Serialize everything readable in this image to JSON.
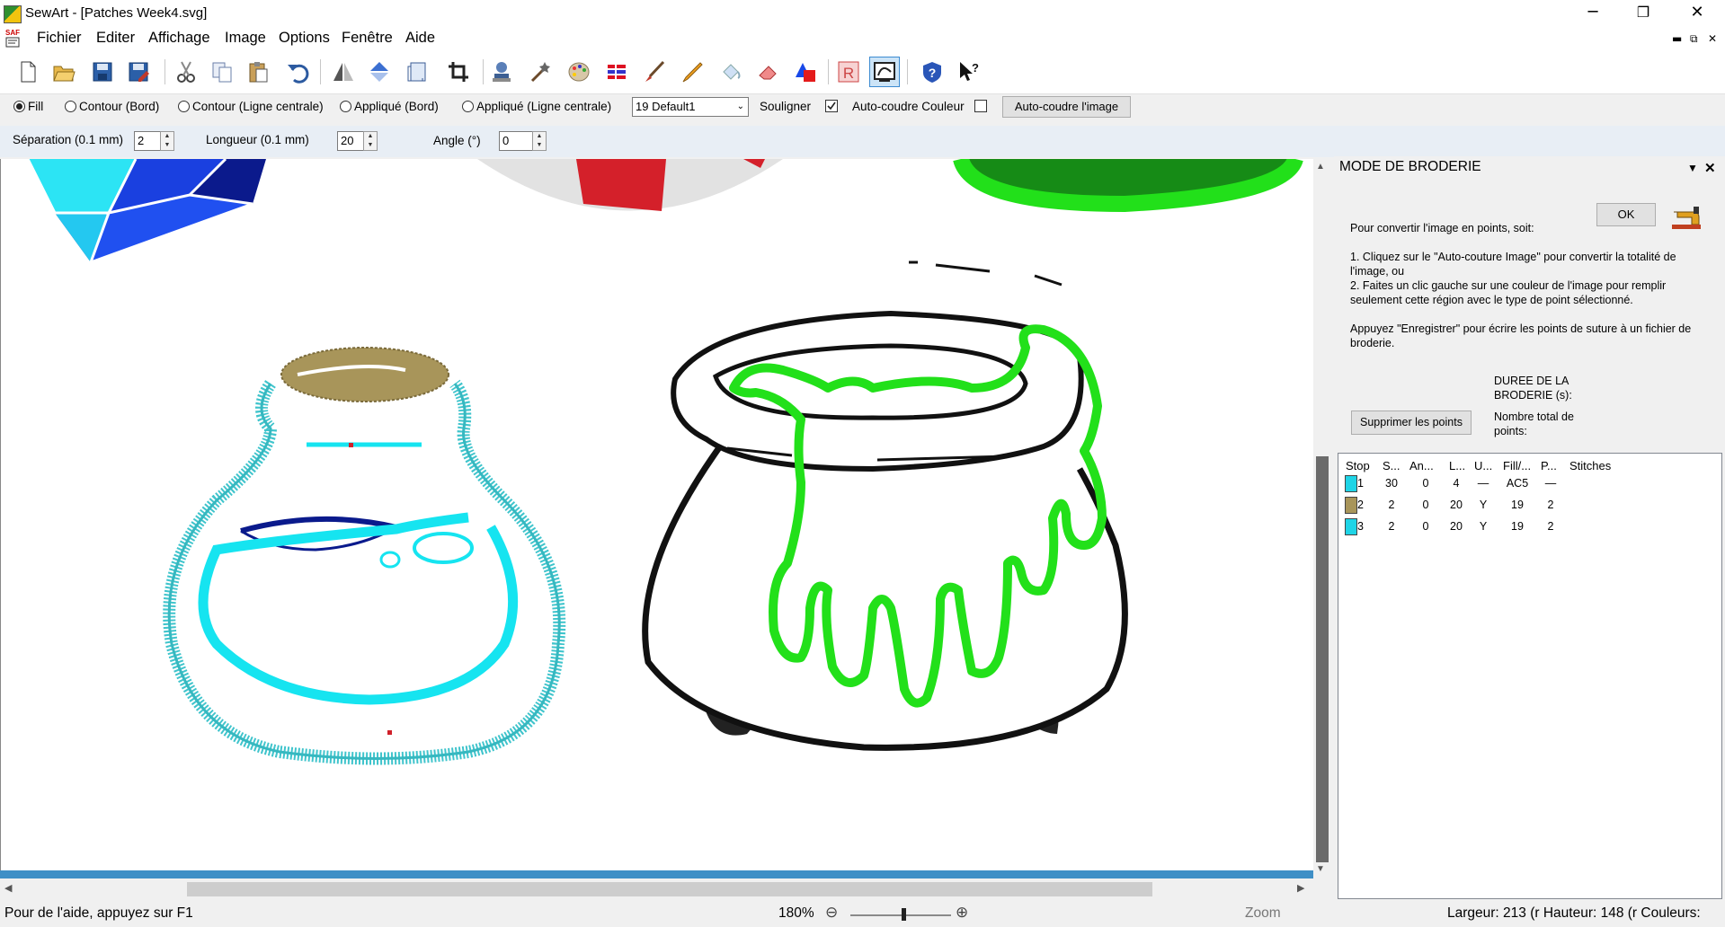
{
  "window": {
    "title": "SewArt - [Patches Week4.svg]",
    "minimize_glyph": "─",
    "restore_glyph": "❐",
    "close_glyph": "✕",
    "mdi_minimize_glyph": "▬",
    "mdi_restore_glyph": "⧉",
    "mdi_close_glyph": "✕"
  },
  "doc_icon_text": "SAF",
  "menu": [
    "Fichier",
    "Editer",
    "Affichage",
    "Image",
    "Options",
    "Fenêtre",
    "Aide"
  ],
  "toolbar_icons": [
    "new-file-icon",
    "open-folder-icon",
    "save-icon",
    "save-as-icon",
    "cut-icon",
    "copy-icon",
    "paste-icon",
    "undo-icon",
    "mirror-icon",
    "flip-icon",
    "rotate-page-icon",
    "crop-icon",
    "stamp-icon",
    "magic-wand-icon",
    "palette-icon",
    "stitch-list-icon",
    "brush-icon",
    "pencil-icon",
    "fill-icon",
    "eraser-icon",
    "shapes-icon",
    "registration-icon",
    "embroidery-mode-icon",
    "help-icon",
    "context-help-icon"
  ],
  "fill_options": {
    "fill": "Fill",
    "contour_edge": "Contour (Bord)",
    "contour_center": "Contour (Ligne centrale)",
    "applique_edge": "Appliqué (Bord)",
    "applique_center": "Appliqué (Ligne centrale)",
    "selected": "fill",
    "pattern_value": "19 Default1",
    "underline_label": "Souligner",
    "underline_checked": true,
    "auto_color_label": "Auto-coudre Couleur",
    "auto_color_checked": false,
    "auto_image_button": "Auto-coudre l'image"
  },
  "params": {
    "separation_label": "Séparation (0.1 mm)",
    "separation_value": "2",
    "length_label": "Longueur (0.1 mm)",
    "length_value": "20",
    "angle_label": "Angle (°)",
    "angle_value": "0"
  },
  "panel": {
    "title": "MODE DE BRODERIE",
    "ok_button": "OK",
    "intro": "Pour convertir l'image en points, soit:",
    "step1": "1. Cliquez sur le \"Auto-couture Image\" pour convertir la totalité de l'image, ou",
    "step2": "2. Faites un clic gauche sur une couleur de l'image pour remplir seulement cette région avec le type de point sélectionné.",
    "save_hint": "Appuyez \"Enregistrer\" pour écrire les points de suture à un fichier de broderie.",
    "duration_label": "DUREE DE LA BRODERIE (s):",
    "total_points_label": "Nombre total de points:",
    "delete_button": "Supprimer les points",
    "columns": [
      "Stop",
      "S...",
      "An...",
      "L...",
      "U...",
      "Fill/...",
      "P...",
      "Stitches"
    ],
    "rows": [
      {
        "stop": "1",
        "color": "#1fd4e6",
        "s": "30",
        "an": "0",
        "l": "4",
        "u": "—",
        "fill": "AC5",
        "p": "—",
        "stitches": ""
      },
      {
        "stop": "2",
        "color": "#a8955a",
        "s": "2",
        "an": "0",
        "l": "20",
        "u": "Y",
        "fill": "19",
        "p": "2",
        "stitches": ""
      },
      {
        "stop": "3",
        "color": "#1fd4e6",
        "s": "2",
        "an": "0",
        "l": "20",
        "u": "Y",
        "fill": "19",
        "p": "2",
        "stitches": ""
      }
    ]
  },
  "status": {
    "help": "Pour de l'aide, appuyez sur F1",
    "zoom_value": "180%",
    "zoom_minus": "⊖",
    "zoom_plus": "⊕",
    "zoom_label": "Zoom",
    "dims": "Largeur: 213 (r Hauteur: 148 (r Couleurs:"
  },
  "colors": {
    "cyan": "#16e4f0",
    "teal_fringe": "#3fc4cc",
    "cork": "#a8955a",
    "green": "#22e01a",
    "navy": "#0a1a8c",
    "accent_blue": "#3f8fc6"
  }
}
